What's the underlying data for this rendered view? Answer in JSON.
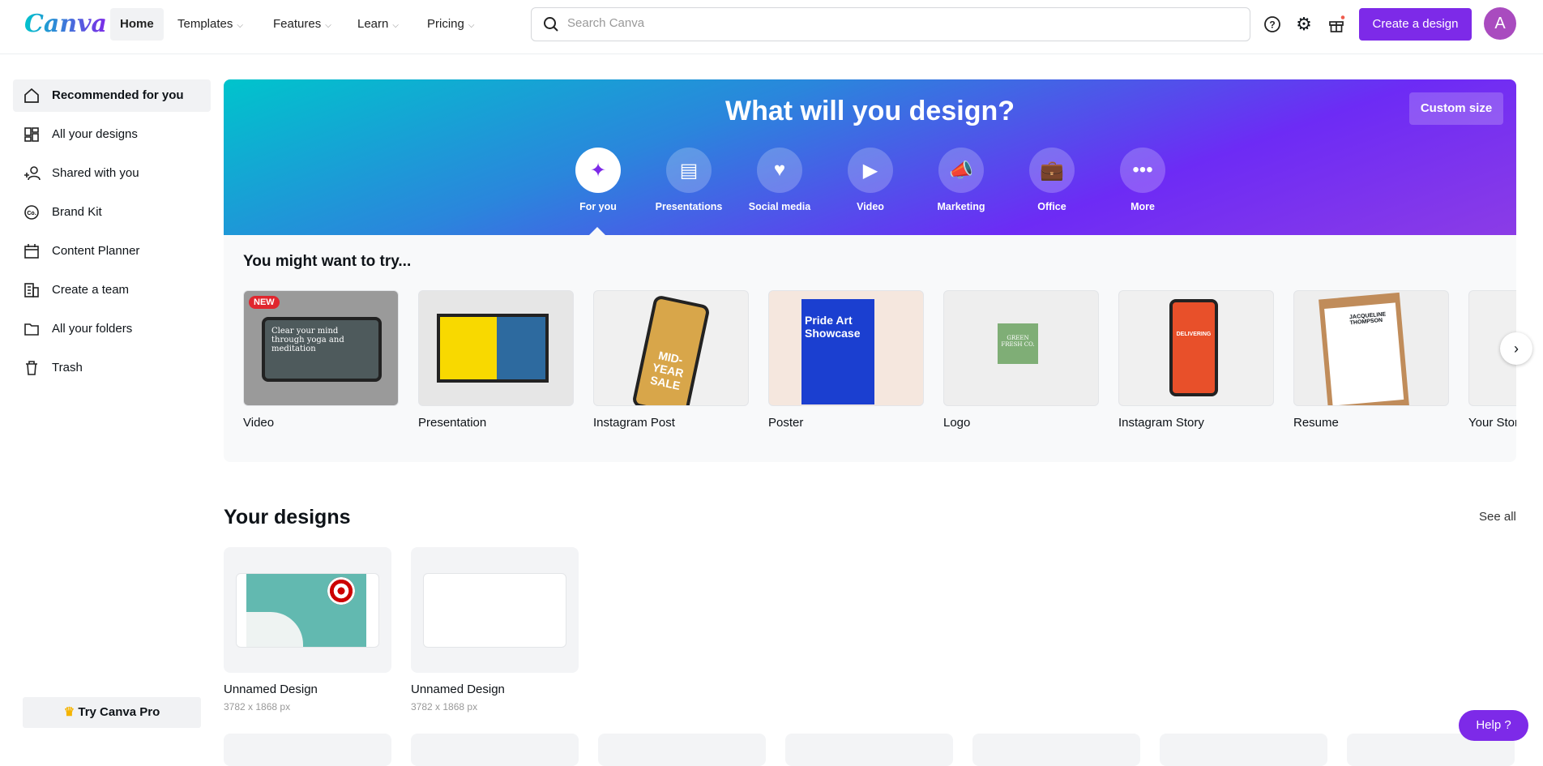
{
  "header": {
    "logo": "Canva",
    "nav": [
      {
        "label": "Home"
      },
      {
        "label": "Templates"
      },
      {
        "label": "Features"
      },
      {
        "label": "Learn"
      },
      {
        "label": "Pricing"
      }
    ],
    "search_placeholder": "Search Canva",
    "create_label": "Create a design",
    "avatar_letter": "A",
    "accent": "#7d2ae8"
  },
  "sidebar": {
    "items": [
      {
        "label": "Recommended for you"
      },
      {
        "label": "All your designs"
      },
      {
        "label": "Shared with you"
      },
      {
        "label": "Brand Kit"
      },
      {
        "label": "Content Planner"
      },
      {
        "label": "Create a team"
      },
      {
        "label": "All your folders"
      },
      {
        "label": "Trash"
      }
    ],
    "pro_label": "Try Canva Pro"
  },
  "hero": {
    "title": "What will you design?",
    "custom_size": "Custom size",
    "categories": [
      {
        "label": "For you",
        "icon": "sparkle-icon"
      },
      {
        "label": "Presentations",
        "icon": "presentation-icon"
      },
      {
        "label": "Social media",
        "icon": "heart-icon"
      },
      {
        "label": "Video",
        "icon": "video-icon"
      },
      {
        "label": "Marketing",
        "icon": "megaphone-icon"
      },
      {
        "label": "Office",
        "icon": "briefcase-icon"
      },
      {
        "label": "More",
        "icon": "more-icon"
      }
    ]
  },
  "try": {
    "title": "You might want to try...",
    "new_badge": "NEW",
    "items": [
      {
        "label": "Video"
      },
      {
        "label": "Presentation"
      },
      {
        "label": "Instagram Post"
      },
      {
        "label": "Poster"
      },
      {
        "label": "Logo"
      },
      {
        "label": "Instagram Story"
      },
      {
        "label": "Resume"
      },
      {
        "label": "Your Story"
      }
    ],
    "thumb_text": {
      "video": "Clear your mind through yoga and meditation",
      "poster": "Pride Art Showcase",
      "logo": "GREEN FRESH CO.",
      "story": "DELIVERING",
      "resume": "JACQUELINE THOMPSON",
      "post": "MID-YEAR SALE"
    }
  },
  "designs": {
    "title": "Your designs",
    "see_all": "See all",
    "items": [
      {
        "name": "Unnamed Design",
        "size": "3782 x 1868 px"
      },
      {
        "name": "Unnamed Design",
        "size": "3782 x 1868 px"
      }
    ]
  },
  "help": {
    "label": "Help ?"
  }
}
